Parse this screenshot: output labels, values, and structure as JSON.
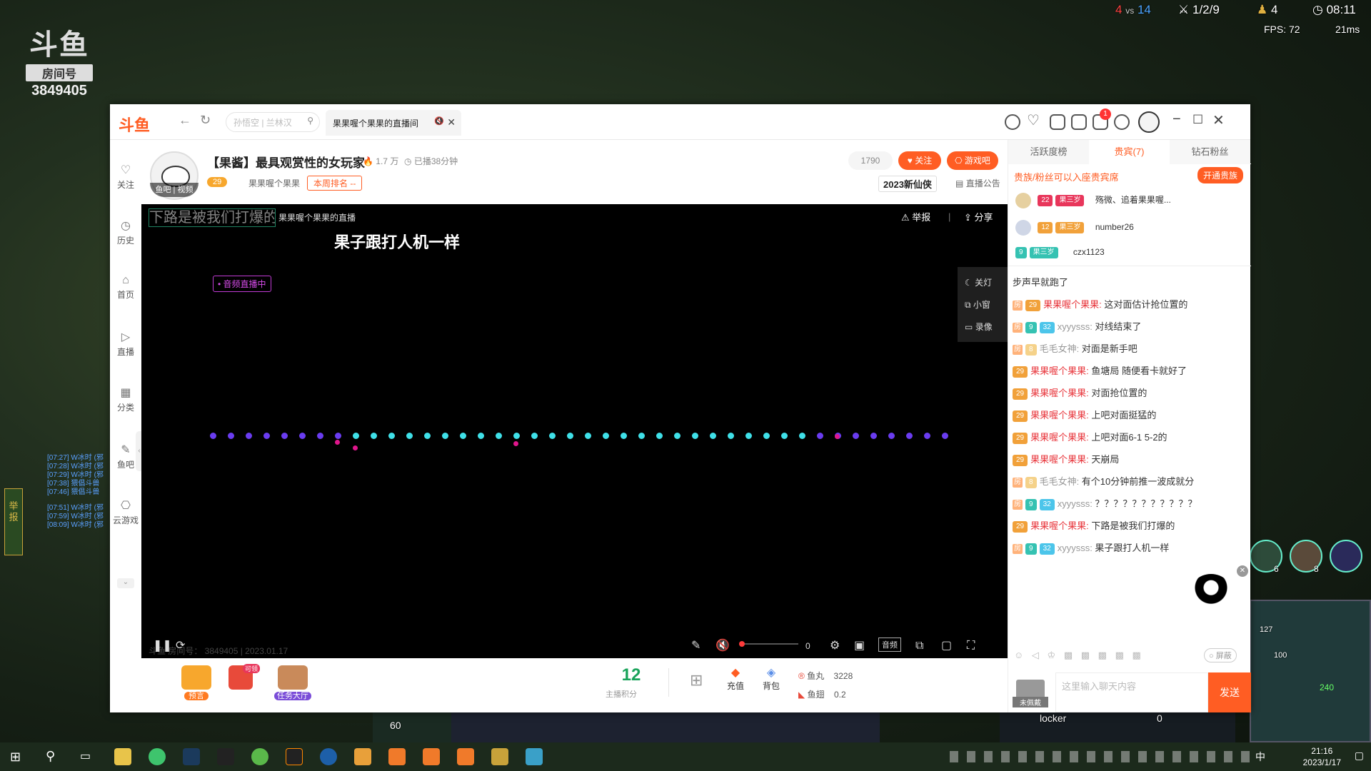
{
  "game": {
    "score_red": "4",
    "score_vs": "vs",
    "score_blue": "14",
    "kda": "1/2/9",
    "cs": "4",
    "time": "08:11",
    "fps": "FPS:  72",
    "ping": "21ms",
    "gold": "60",
    "player_name": "locker",
    "player_score": "0",
    "map_nums": [
      "127",
      "100",
      "240"
    ],
    "champ_levels": [
      "6",
      "8"
    ],
    "report_side": "举报",
    "log_lines": [
      "[07:27] W冰时 (邪",
      "[07:28] W冰时 (邪",
      "[07:29] W冰时 (邪",
      "[07:38] 猥倡斗兽",
      "[07:46] 猥倡斗兽",
      "[07:51] W冰时 (邪",
      "[07:59] W冰时 (邪",
      "[08:09] W冰时 (邪"
    ]
  },
  "overlay_logo": {
    "brand": "斗鱼",
    "room_label": "房间号",
    "room_number": "3849405"
  },
  "browser": {
    "brand": "斗鱼",
    "search_placeholder": "孙悟空 | 兰林汉",
    "tab_title": "果果喔个果果的直播间",
    "tab_close": "✕",
    "tab_mute": "🔇",
    "notif_count": "1"
  },
  "sidebar": {
    "items": [
      {
        "label": "关注",
        "icon": "♡"
      },
      {
        "label": "历史",
        "icon": "◷"
      },
      {
        "label": "首页",
        "icon": "⌂"
      },
      {
        "label": "直播",
        "icon": "▷"
      },
      {
        "label": "分类",
        "icon": "▦"
      },
      {
        "label": "鱼吧",
        "icon": "✎"
      },
      {
        "label": "云游戏",
        "icon": "⎔"
      }
    ]
  },
  "room": {
    "title": "【果酱】最具观赏性的女玩家",
    "heat": "1.7 万",
    "duration": "已播38分钟",
    "avatar_tag": "鱼吧 | 视频",
    "fan_level": "29",
    "anchor_name": "果果喔个果果",
    "rank": "本周排名 --",
    "follower_count": "1790",
    "follow_label": "关注",
    "game_bar_label": "游戏吧",
    "badge_text": "2023新仙侠",
    "notice_label": "直播公告"
  },
  "player": {
    "overlay_title": "下路是被我们打爆的",
    "overlay_sub": "果果喔个果果的直播",
    "danmu": "果子跟打人机一样",
    "audio_live": "• 音频直播中",
    "report": "举报",
    "share": "分享",
    "side_buttons": [
      "关灯",
      "小窗",
      "录像"
    ],
    "watermark": "斗鱼 房间号： 3849405 | 2023.01.17",
    "volume": "0",
    "audio_btn": "音频",
    "wave_colors": [
      "#6a3cf0",
      "#3fe0e8",
      "#e0168c"
    ]
  },
  "bottom_bar": {
    "items": [
      {
        "label": "预言"
      },
      {
        "label": "可领"
      },
      {
        "label": "任务大厅"
      }
    ],
    "points": "12",
    "points_label": "主播积分",
    "recharge": "充值",
    "bag": "背包",
    "fish_ball_label": "鱼丸",
    "fish_ball": "3228",
    "fish_fin_label": "鱼翅",
    "fish_fin": "0.2"
  },
  "right": {
    "tabs": [
      "活跃度榜",
      "贵宾(7)",
      "钻石粉丝"
    ],
    "vip_hint": "贵族/粉丝可以入座贵宾席",
    "vip_btn": "开通贵族",
    "vip_users": [
      {
        "badge": "22",
        "fan": "果三岁",
        "name": "殇微、追着果果喔..."
      },
      {
        "badge": "12",
        "fan": "果三岁",
        "name": "number26"
      },
      {
        "badge": "9",
        "fan": "果三岁",
        "name": "czx1123"
      }
    ],
    "messages": [
      {
        "text": "步声早就跑了"
      },
      {
        "badge": "29",
        "nick": "果果喔个果果:",
        "text": " 这对面估计抢位置的",
        "anchor": true
      },
      {
        "badge": "9",
        "badge2": "32",
        "nick": "xyyysss:",
        "text": " 对线结束了"
      },
      {
        "badge": "8",
        "nick": "毛毛女神:",
        "text": " 对面是新手吧"
      },
      {
        "badge": "29",
        "nick": "果果喔个果果:",
        "text": " 鱼塘局 随便看卡就好了",
        "anchor": true
      },
      {
        "badge": "29",
        "nick": "果果喔个果果:",
        "text": " 对面抢位置的",
        "anchor": true
      },
      {
        "badge": "29",
        "nick": "果果喔个果果:",
        "text": " 上吧对面挺猛的",
        "anchor": true
      },
      {
        "badge": "29",
        "nick": "果果喔个果果:",
        "text": " 上吧对面6-1 5-2的",
        "anchor": true
      },
      {
        "badge": "29",
        "nick": "果果喔个果果:",
        "text": " 天崩局",
        "anchor": true
      },
      {
        "badge": "8",
        "nick": "毛毛女神:",
        "text": " 有个10分钟前推一波成就分"
      },
      {
        "badge": "9",
        "badge2": "32",
        "nick": "xyyysss:",
        "text": " ？？？？？？？？？？？"
      },
      {
        "badge": "29",
        "nick": "果果喔个果果:",
        "text": " 下路是被我们打爆的",
        "anchor": true
      },
      {
        "badge": "9",
        "badge2": "32",
        "nick": "xyyysss:",
        "text": " 果子跟打人机一样"
      }
    ],
    "shield_label": "屏蔽",
    "input_placeholder": "这里输入聊天内容",
    "send": "发送",
    "avatar_label": "未佩戴"
  },
  "taskbar": {
    "time": "21:16",
    "date": "2023/1/17",
    "ime": "中"
  }
}
